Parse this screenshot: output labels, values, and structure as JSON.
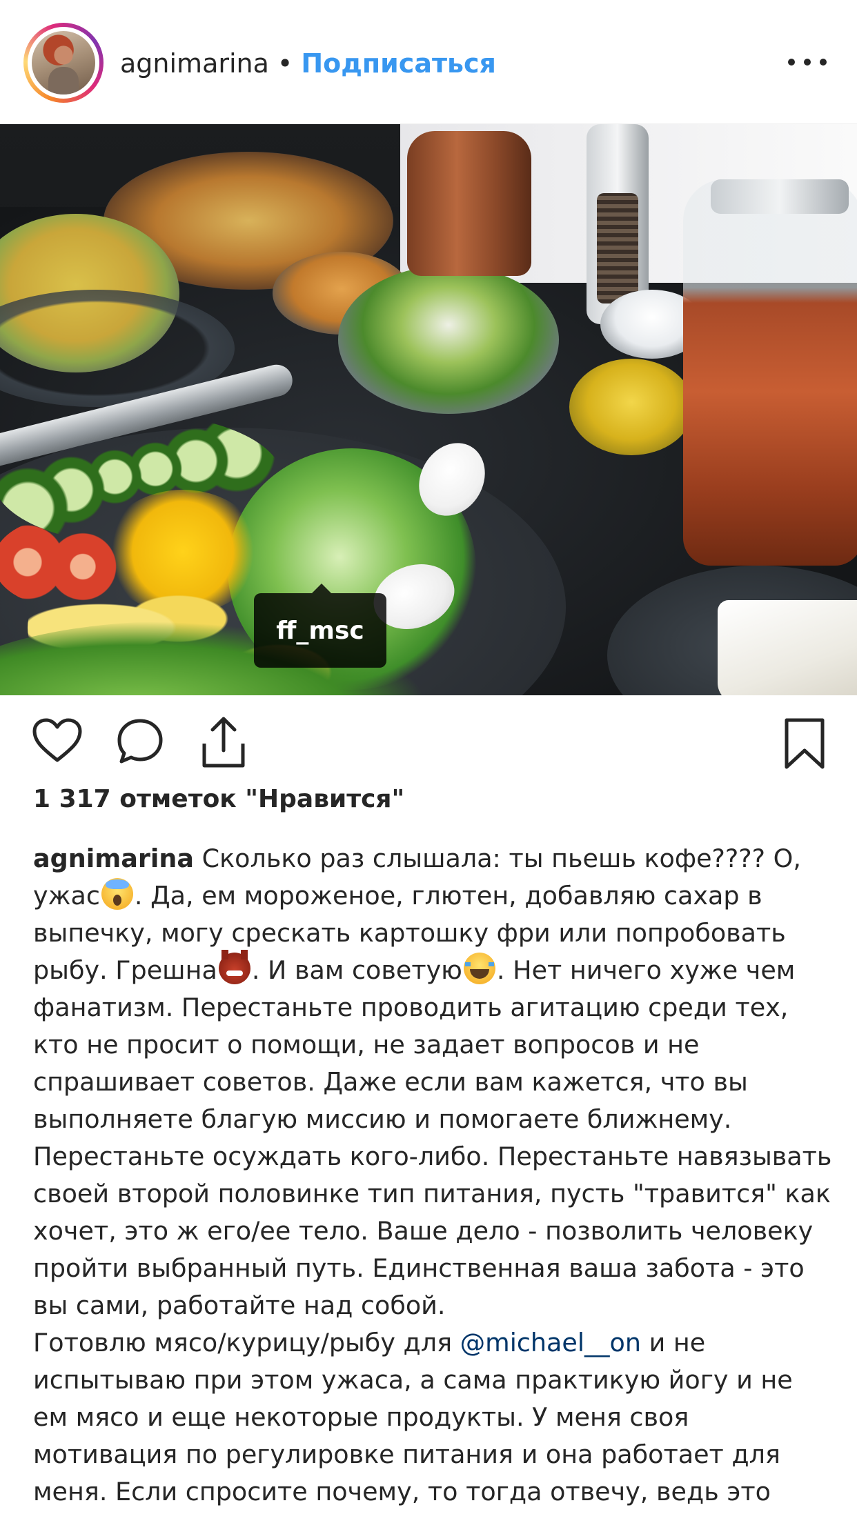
{
  "header": {
    "username": "agnimarina",
    "separator": "•",
    "follow_label": "Подписаться",
    "more_icon": "more-horizontal-icon"
  },
  "photo": {
    "tag_label": "ff_msc",
    "user_tag_icon": "user-icon"
  },
  "actions": {
    "like_icon": "heart-icon",
    "comment_icon": "comment-icon",
    "share_icon": "share-icon",
    "save_icon": "bookmark-icon"
  },
  "likes_text": "1 317 отметок \"Нравится\"",
  "caption": {
    "author": "agnimarina",
    "line1_text": " Сколько раз слышала: ты пьешь кофе???? О,",
    "line2a": "ужас",
    "line2b": ". Да, ем мороженое, глютен, добавляю сахар в",
    "line3": "выпечку, могу срескать картошку фри или попробовать",
    "line4a": "рыбу. Грешна",
    "line4b": ". И вам советую",
    "line4c": ". Нет ничего хуже чем",
    "line5": "фанатизм.  Перестаньте проводить агитацию среди тех,",
    "line6": "кто не просит о помощи, не задает вопросов и не",
    "line7": "спрашивает советов. Даже если вам кажется, что вы",
    "line8": "выполняете благую миссию и помогаете ближнему.",
    "line9": "Перестаньте осуждать кого-либо. Перестаньте навязывать",
    "line10": "своей второй половинке тип питания, пусть \"травится\" как",
    "line11": "хочет, это ж его/ее тело. Ваше дело - позволить человеку",
    "line12": "пройти выбранный путь. Единственная ваша забота - это",
    "line13": "вы сами, работайте над собой.",
    "line14a": "Готовлю мясо/курицу/рыбу для ",
    "mention": "@michael__on",
    "line14b": " и не",
    "line15": "испытываю при этом ужаса, а сама практикую йогу и не",
    "line16": "ем мясо и еще некоторые продукты. У меня своя",
    "line17": "мотивация по регулировке питания и она работает для",
    "line18": "меня. Если спросите почему, то тогда отвечу, ведь это",
    "emoji_1": "scream-emoji",
    "emoji_2": "devil-emoji",
    "emoji_3": "laughing-emoji"
  }
}
